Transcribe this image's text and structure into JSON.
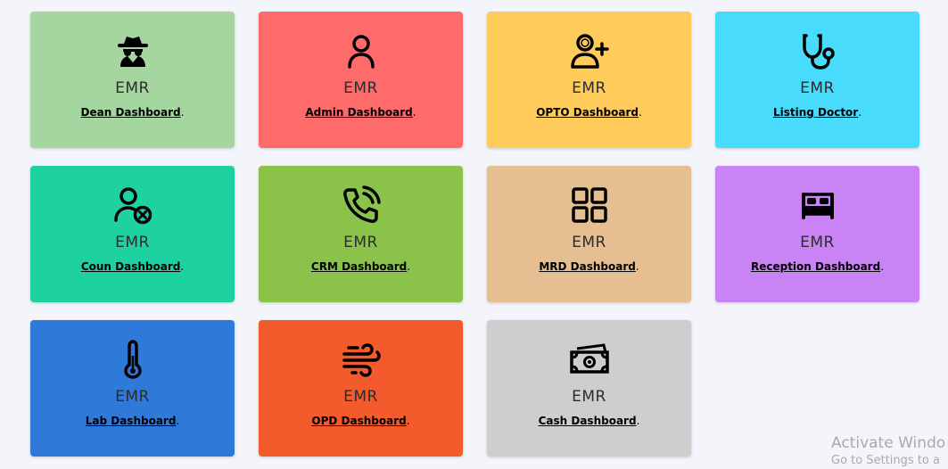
{
  "cards": [
    {
      "icon": "spy-icon",
      "emr": "EMR",
      "link": "Dean Dashboard",
      "suffix": ".",
      "color": "#a5d6a0"
    },
    {
      "icon": "user-icon",
      "emr": "EMR",
      "link": "Admin Dashboard",
      "suffix": ".",
      "color": "#ff6a6a"
    },
    {
      "icon": "user-plus-icon",
      "emr": "EMR",
      "link": "OPTO Dashboard",
      "suffix": ".",
      "color": "#ffcb5a"
    },
    {
      "icon": "stethoscope-icon",
      "emr": "EMR",
      "link": "Listing Doctor",
      "suffix": ".",
      "color": "#48dbfb"
    },
    {
      "icon": "user-cancel-icon",
      "emr": "EMR",
      "link": "Coun Dashboard",
      "suffix": ".",
      "color": "#1dd1a1"
    },
    {
      "icon": "phone-call-icon",
      "emr": "EMR",
      "link": "CRM Dashboard",
      "suffix": ".",
      "color": "#8bc34a"
    },
    {
      "icon": "grid-icon",
      "emr": "EMR",
      "link": "MRD Dashboard",
      "suffix": ".",
      "color": "#e5bf91"
    },
    {
      "icon": "bed-icon",
      "emr": "EMR",
      "link": "Reception Dashboard",
      "suffix": ".",
      "color": "#c983f5"
    },
    {
      "icon": "thermometer-icon",
      "emr": "EMR",
      "link": "Lab Dashboard",
      "suffix": ".",
      "color": "#2f7ad9"
    },
    {
      "icon": "wind-icon",
      "emr": "EMR",
      "link": "OPD Dashboard",
      "suffix": ".",
      "color": "#f45b2c"
    },
    {
      "icon": "money-icon",
      "emr": "EMR",
      "link": "Cash Dashboard",
      "suffix": ".",
      "color": "#cecece"
    }
  ],
  "watermark": {
    "line1": "Activate Windo",
    "line2": "Go to Settings to a"
  }
}
